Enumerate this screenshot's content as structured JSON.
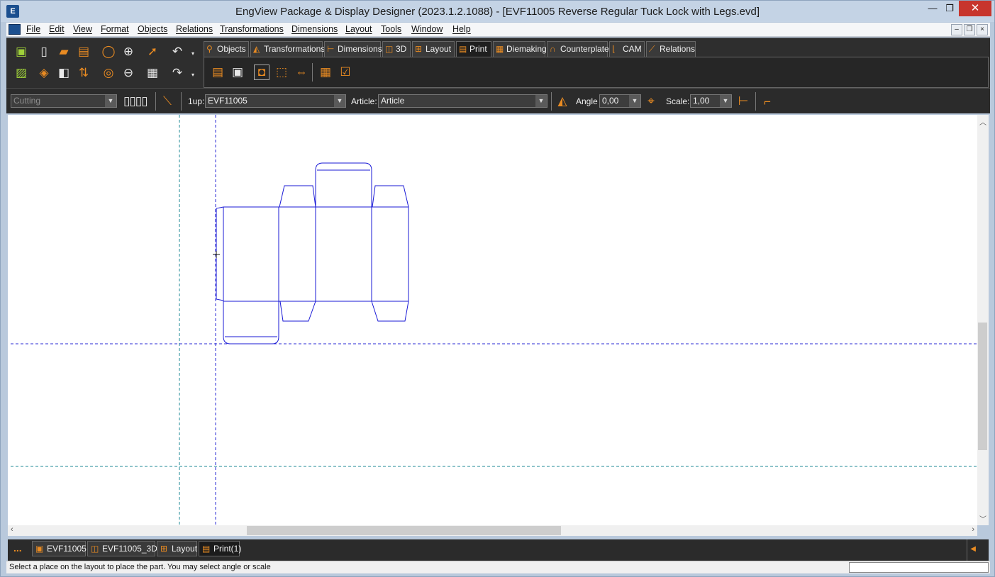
{
  "window": {
    "title": "EngView Package & Display Designer (2023.1.2.1088) - [EVF11005 Reverse Regular Tuck Lock with Legs.evd]",
    "min_glyph": "—",
    "max_glyph": "❐",
    "close_glyph": "✕"
  },
  "menu": [
    {
      "label": "File"
    },
    {
      "label": "Edit"
    },
    {
      "label": "View"
    },
    {
      "label": "Format"
    },
    {
      "label": "Objects"
    },
    {
      "label": "Relations"
    },
    {
      "label": "Transformations"
    },
    {
      "label": "Dimensions"
    },
    {
      "label": "Layout"
    },
    {
      "label": "Tools"
    },
    {
      "label": "Window"
    },
    {
      "label": "Help"
    }
  ],
  "mdi": {
    "min": "–",
    "restore": "❐",
    "close": "×"
  },
  "ribbon": {
    "tabs": [
      {
        "label": "Objects",
        "icon": "objects-icon"
      },
      {
        "label": "Transformations",
        "icon": "transformations-icon"
      },
      {
        "label": "Dimensions",
        "icon": "dimensions-icon"
      },
      {
        "label": "3D",
        "icon": "3d-icon"
      },
      {
        "label": "Layout",
        "icon": "layout-icon"
      },
      {
        "label": "Print",
        "icon": "print-icon"
      },
      {
        "label": "Diemaking",
        "icon": "diemaking-icon"
      },
      {
        "label": "Counterplate",
        "icon": "counterplate-icon"
      },
      {
        "label": "CAM",
        "icon": "cam-icon"
      },
      {
        "label": "Relations",
        "icon": "relations-icon"
      }
    ],
    "active_tab": "Print"
  },
  "options": {
    "mode_value": "Cutting",
    "oneup_label": "1up:",
    "oneup_value": "EVF11005",
    "article_label": "Article:",
    "article_value": "Article",
    "angle_label": "Angle",
    "angle_value": "0,00",
    "scale_label": "Scale:",
    "scale_value": "1,00"
  },
  "documents": {
    "more": "...",
    "tabs": [
      {
        "label": "EVF11005",
        "icon": "design-doc-icon"
      },
      {
        "label": "EVF11005_3D",
        "icon": "3d-doc-icon"
      },
      {
        "label": "Layout",
        "icon": "layout-doc-icon"
      },
      {
        "label": "Print(1)",
        "icon": "print-doc-icon"
      }
    ]
  },
  "status": {
    "message": "Select a place on the layout to place the part. You may select angle or scale"
  },
  "colors": {
    "outline": "#1a1ad6",
    "guide": "#2a2ad6",
    "guide_teal": "#1e8a96",
    "accent": "#e98b22"
  }
}
